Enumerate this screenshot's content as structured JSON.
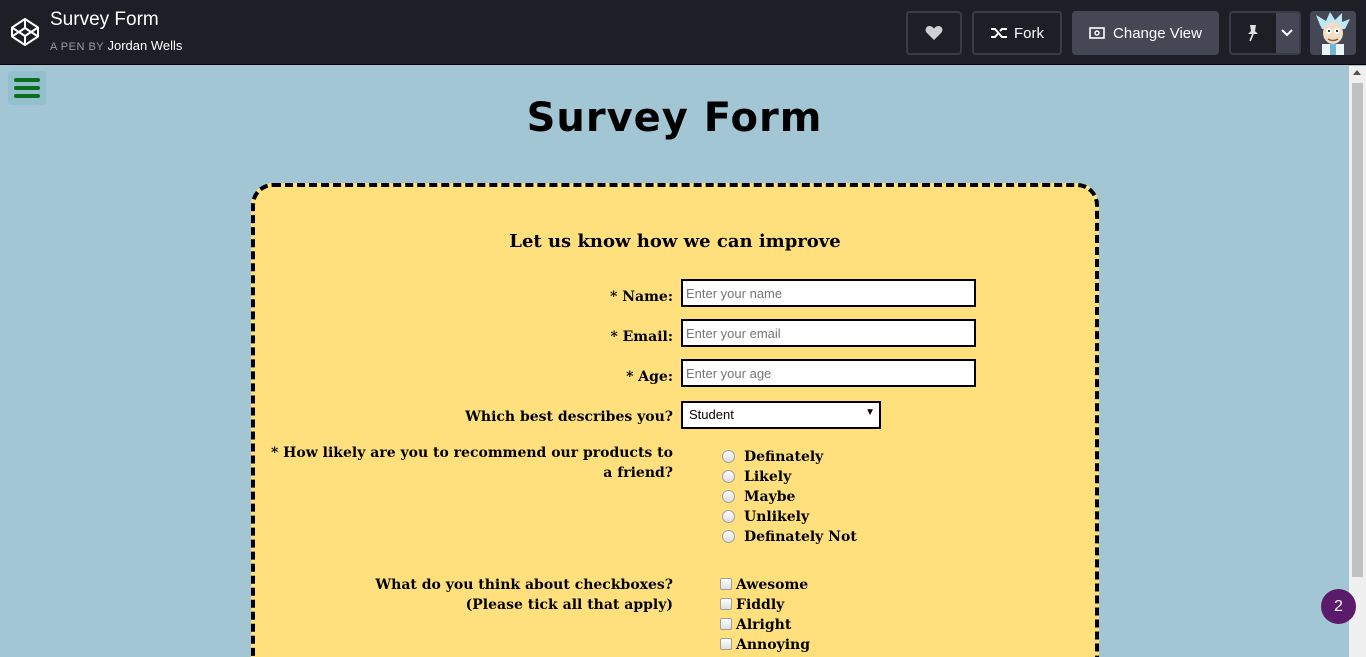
{
  "header": {
    "title": "Survey Form",
    "pen_by_prefix": "A PEN BY",
    "author": "Jordan Wells",
    "fork_label": "Fork",
    "change_view_label": "Change View"
  },
  "page": {
    "title": "Survey Form"
  },
  "form": {
    "heading": "Let us know how we can improve",
    "name_label": "* Name:",
    "name_placeholder": "Enter your name",
    "email_label": "* Email:",
    "email_placeholder": "Enter your email",
    "age_label": "* Age:",
    "age_placeholder": "Enter your age",
    "describe_label": "Which best describes you?",
    "describe_selected": "Student",
    "recommend_label_1": "* How likely are you to recommend our products to",
    "recommend_label_2": "a friend?",
    "recommend_options": [
      "Definately",
      "Likely",
      "Maybe",
      "Unlikely",
      "Definately Not"
    ],
    "checkbox_label_1": "What do you think about checkboxes?",
    "checkbox_label_2": "(Please tick all that apply)",
    "checkbox_options": [
      "Awesome",
      "Fiddly",
      "Alright",
      "Annoying"
    ]
  },
  "notification_count": "2",
  "colors": {
    "background": "#a2c6d4",
    "card": "#ffe07d",
    "topbar": "#1e1f26",
    "menu_icon": "#0a6e1f",
    "badge": "#5c1a6b"
  }
}
